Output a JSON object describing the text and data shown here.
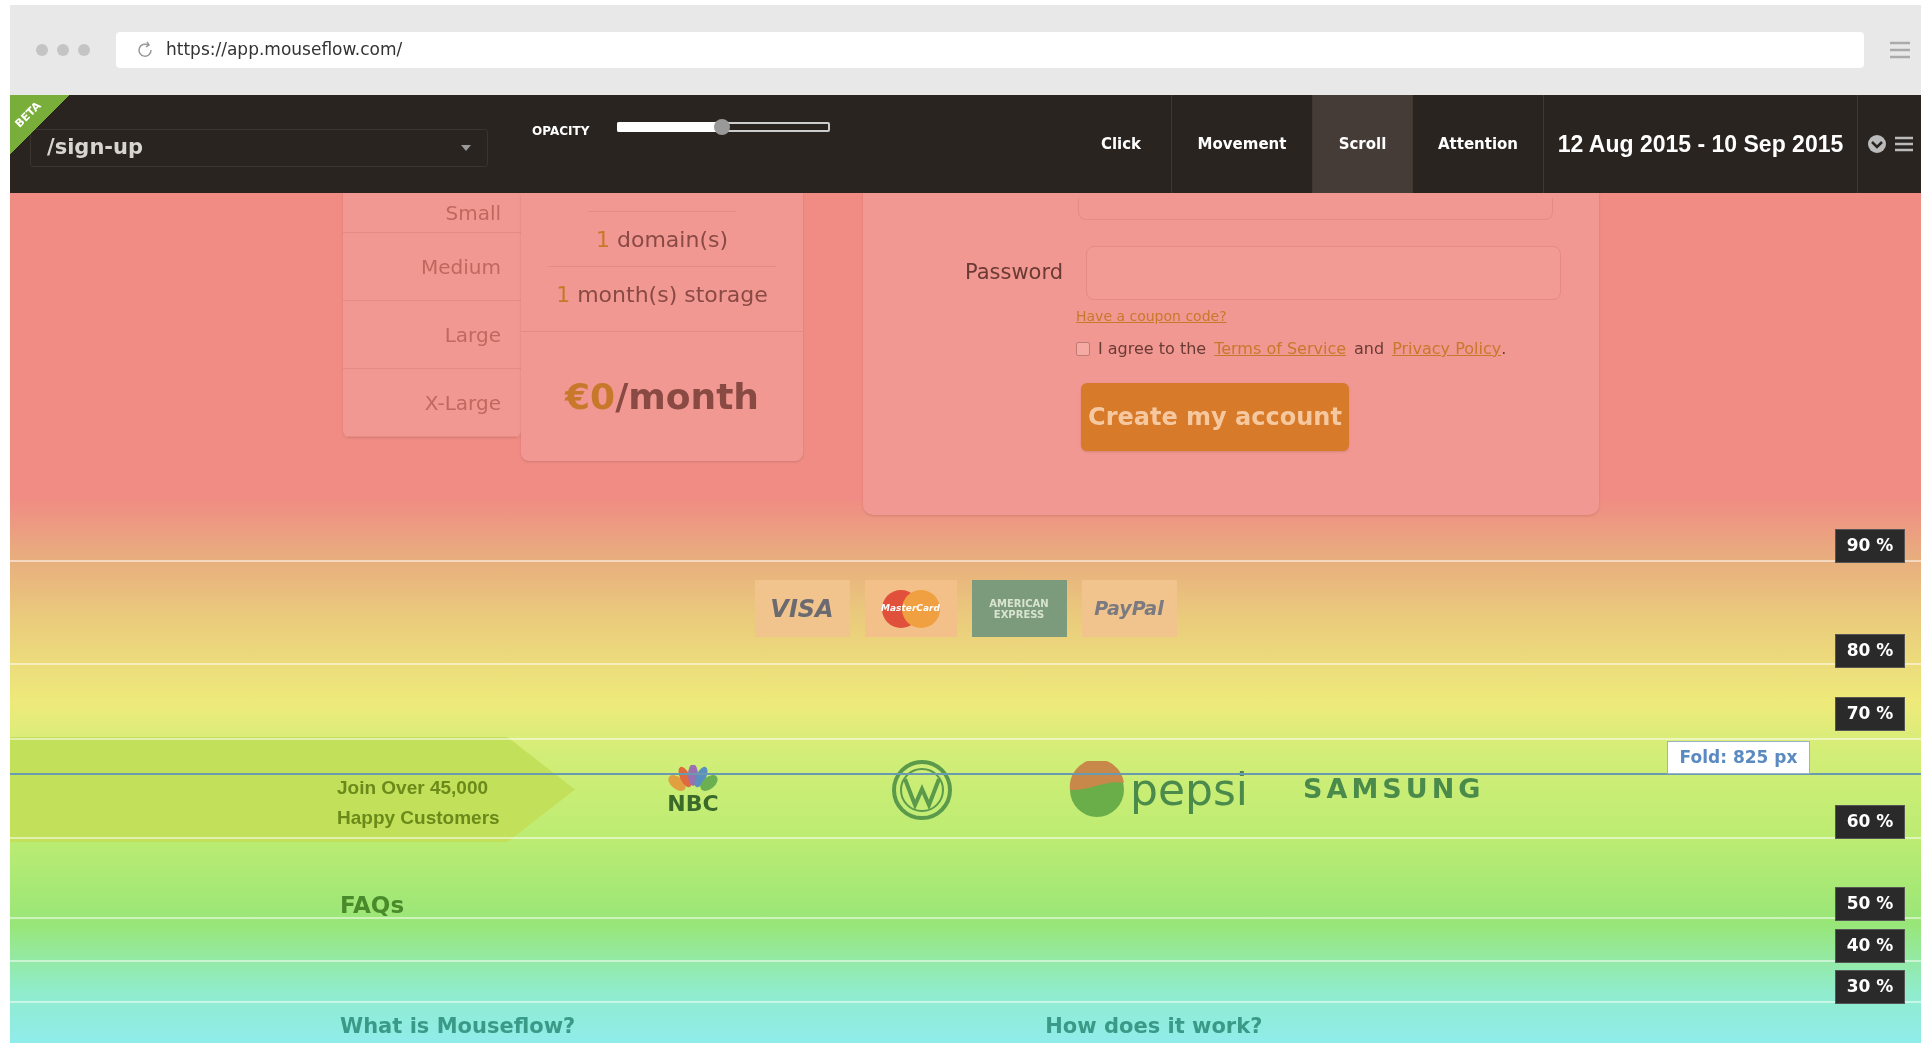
{
  "browser": {
    "url": "https://app.mouseflow.com/"
  },
  "toolbar": {
    "badge": "BETA",
    "page_select": {
      "value": "/sign-up"
    },
    "opacity": {
      "label": "OPACITY",
      "level": 0.49
    },
    "tabs": [
      {
        "label": "Click",
        "selected": false
      },
      {
        "label": "Movement",
        "selected": false
      },
      {
        "label": "Scroll",
        "selected": true
      },
      {
        "label": "Attention",
        "selected": false
      }
    ],
    "date_range": "12 Aug 2015 - 10 Sep 2015"
  },
  "plan": {
    "sizes": [
      "Small",
      "Medium",
      "Large",
      "X-Large"
    ],
    "features": [
      {
        "count": "1",
        "text": "domain(s)"
      },
      {
        "count": "1",
        "text": "month(s) storage"
      }
    ],
    "price": {
      "amount": "€0",
      "period": "/month"
    }
  },
  "form": {
    "password_label": "Password",
    "coupon_link": "Have a coupon code?",
    "agree": {
      "checked": false,
      "before": "I agree to the",
      "terms": "Terms of Service",
      "middle": "and",
      "privacy": "Privacy Policy",
      "after": "."
    },
    "submit": "Create my account"
  },
  "payment_methods": [
    {
      "kind": "visa",
      "label": "VISA"
    },
    {
      "kind": "mastercard",
      "label": "MasterCard"
    },
    {
      "kind": "amex",
      "label": "AMERICAN EXPRESS"
    },
    {
      "kind": "paypal",
      "label": "PayPal"
    }
  ],
  "customers": {
    "headline": [
      "Join Over 45,000",
      "Happy Customers"
    ],
    "logos": [
      {
        "kind": "peacock",
        "label": "NBC"
      },
      {
        "kind": "roundel"
      },
      {
        "kind": "globe",
        "label": "pepsi"
      },
      {
        "kind": "wordmark",
        "label": "SAMSUNG"
      }
    ]
  },
  "faq": {
    "title": "FAQs",
    "questions": [
      "What is Mouseflow?",
      "How does it work?"
    ]
  },
  "fold": "Fold: 825 px",
  "scroll_markers": [
    {
      "label": "90 %"
    },
    {
      "label": "80 %"
    },
    {
      "label": "70 %"
    },
    {
      "label": "60 %"
    },
    {
      "label": "50 %"
    },
    {
      "label": "40 %"
    },
    {
      "label": "30 %"
    }
  ]
}
